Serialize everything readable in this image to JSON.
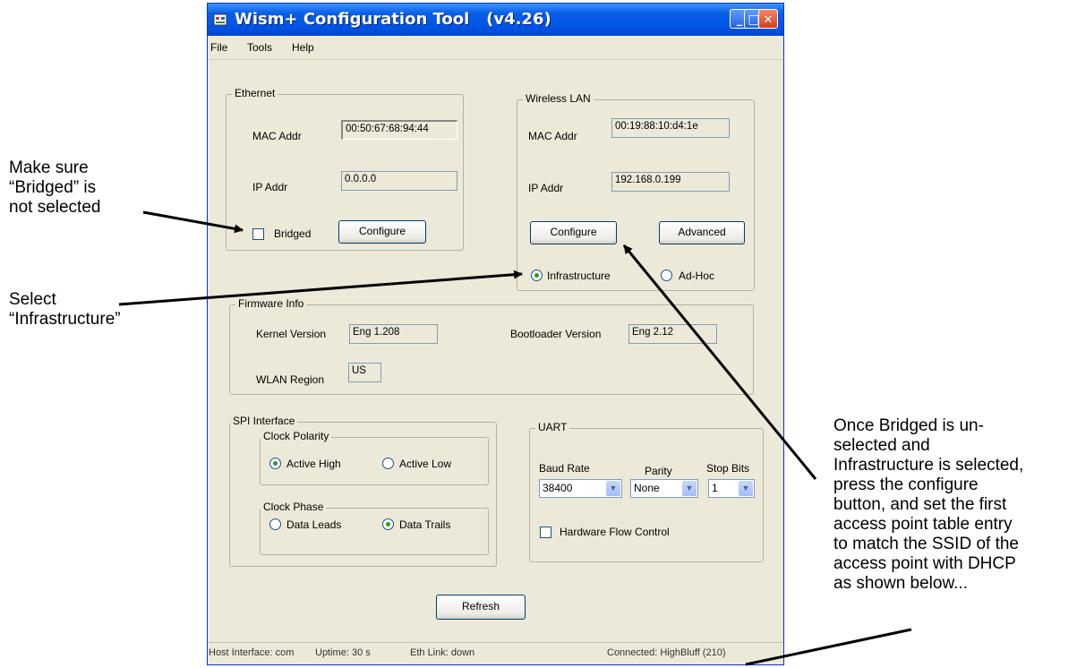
{
  "window": {
    "title": "Wism+ Configuration Tool   (v4.26)",
    "minimize_glyph": "_",
    "maximize_glyph": "□",
    "close_glyph": "✕"
  },
  "menu": {
    "file": "File",
    "tools": "Tools",
    "help": "Help"
  },
  "ethernet": {
    "legend": "Ethernet",
    "mac_label": "MAC Addr",
    "mac_value": "00:50:67:68:94:44",
    "ip_label": "IP Addr",
    "ip_value": "0.0.0.0",
    "bridged_label": "Bridged",
    "bridged_checked": false,
    "configure_label": "Configure"
  },
  "wireless": {
    "legend": "Wireless LAN",
    "mac_label": "MAC Addr",
    "mac_value": "00:19:88:10:d4:1e",
    "ip_label": "IP Addr",
    "ip_value": "192.168.0.199",
    "configure_label": "Configure",
    "advanced_label": "Advanced",
    "infrastructure_label": "Infrastructure",
    "adhoc_label": "Ad-Hoc",
    "selected_mode": "Infrastructure"
  },
  "firmware": {
    "legend": "Firmware Info",
    "kernel_label": "Kernel Version",
    "kernel_value": "Eng 1.208",
    "bootloader_label": "Bootloader Version",
    "bootloader_value": "Eng 2.12",
    "region_label": "WLAN Region",
    "region_value": "US"
  },
  "spi": {
    "legend": "SPI Interface",
    "polarity_legend": "Clock Polarity",
    "active_high": "Active High",
    "active_low": "Active Low",
    "phase_legend": "Clock Phase",
    "data_leads": "Data Leads",
    "data_trails": "Data Trails"
  },
  "uart": {
    "legend": "UART",
    "baud_label": "Baud Rate",
    "baud_value": "38400",
    "parity_label": "Parity",
    "parity_value": "None",
    "stop_label": "Stop Bits",
    "stop_value": "1",
    "flow_label": "Hardware Flow Control"
  },
  "refresh_label": "Refresh",
  "status": {
    "host": "Host Interface: com",
    "uptime": "Uptime: 30 s",
    "eth_link": "Eth Link: down",
    "connected": "Connected: HighBluff (210)"
  },
  "annotations": {
    "bridged_note": [
      "Make sure",
      "“Bridged” is",
      "not selected"
    ],
    "infra_note": [
      "Select",
      "“Infrastructure”"
    ],
    "configure_note": [
      "Once Bridged is un-",
      "selected and",
      "Infrastructure is selected,",
      "press the configure",
      "button, and set the first",
      "access point table entry",
      "to match the SSID of the",
      "access point with DHCP",
      "as shown below..."
    ]
  },
  "colors": {
    "titlebar": "#0055e5",
    "window_face": "#ece9d8",
    "radio_dot": "#21a121"
  }
}
